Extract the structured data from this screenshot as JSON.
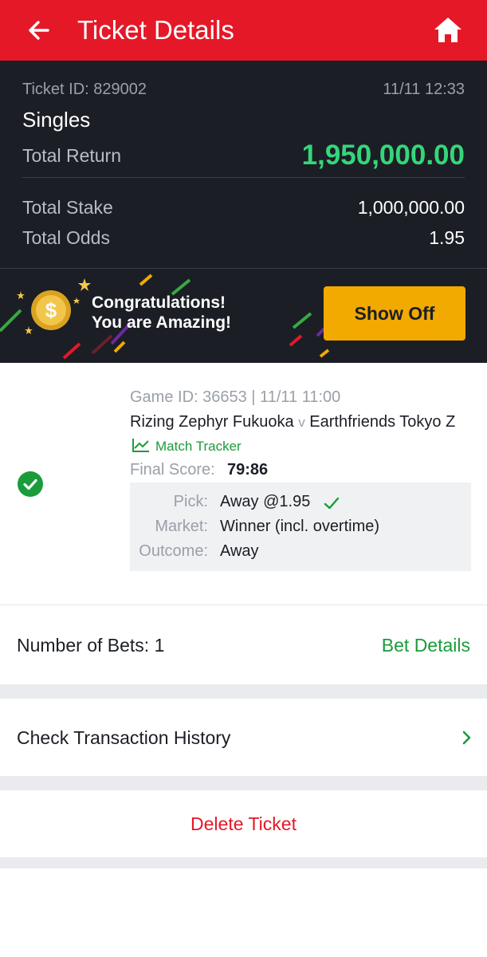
{
  "header": {
    "title": "Ticket Details",
    "back_icon": "arrow-left-icon",
    "home_icon": "home-icon",
    "background_color": "#e41827"
  },
  "ticket": {
    "id_text": "Ticket ID: 829002",
    "date_time": "11/11 12:33",
    "type": "Singles",
    "total_return_label": "Total Return",
    "total_return_value": "1,950,000.00",
    "total_stake_label": "Total Stake",
    "total_stake_value": "1,000,000.00",
    "total_odds_label": "Total Odds",
    "total_odds_value": "1.95",
    "return_color": "#35d67a"
  },
  "banner": {
    "line1": "Congratulations!",
    "line2": "You are Amazing!",
    "show_off_label": "Show Off",
    "coin_icon": "dollar-coin-icon",
    "button_color": "#f2a900"
  },
  "game": {
    "status_icon": "check-circle-icon",
    "game_info": "Game ID: 36653 | 11/11 11:00",
    "home_team": "Rizing Zephyr Fukuoka",
    "versus": "v",
    "away_team": "Earthfriends Tokyo Z",
    "tracker_label": "Match Tracker",
    "tracker_icon": "line-chart-icon",
    "final_score_label": "Final Score:",
    "final_score_value": "79:86",
    "pick_label": "Pick:",
    "pick_value": "Away @1.95",
    "pick_status_icon": "checkmark-icon",
    "market_label": "Market:",
    "market_value": "Winner (incl. overtime)",
    "outcome_label": "Outcome:",
    "outcome_value": "Away"
  },
  "bets": {
    "count_text": "Number of Bets: 1",
    "details_label": "Bet Details"
  },
  "history": {
    "label": "Check Transaction History",
    "chevron_icon": "chevron-right-icon"
  },
  "delete": {
    "label": "Delete Ticket"
  }
}
